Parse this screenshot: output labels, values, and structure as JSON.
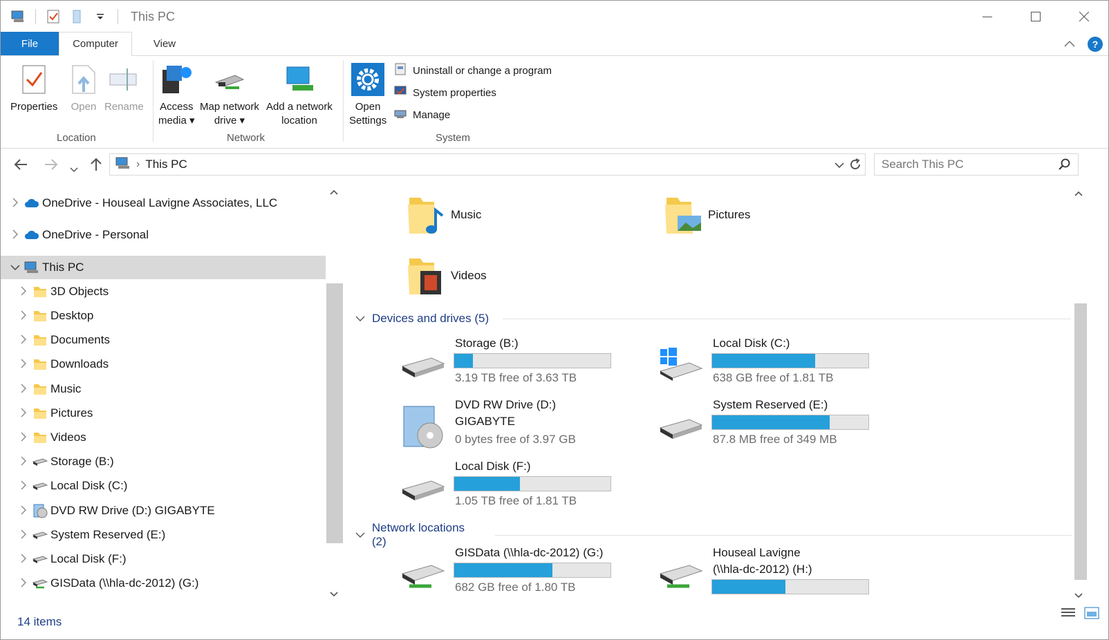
{
  "window": {
    "title": "This PC"
  },
  "tabs": {
    "file": "File",
    "computer": "Computer",
    "view": "View"
  },
  "ribbon": {
    "location": {
      "group_label": "Location",
      "properties": "Properties",
      "open": "Open",
      "rename": "Rename"
    },
    "network": {
      "group_label": "Network",
      "access_media": [
        "Access",
        "media"
      ],
      "map_drive": [
        "Map network",
        "drive"
      ],
      "add_location": [
        "Add a network",
        "location"
      ]
    },
    "system": {
      "group_label": "System",
      "open_settings": [
        "Open",
        "Settings"
      ],
      "uninstall": "Uninstall or change a program",
      "system_properties": "System properties",
      "manage": "Manage"
    }
  },
  "address": {
    "crumb": "This PC",
    "search_placeholder": "Search This PC"
  },
  "nav": {
    "items": [
      {
        "label": "OneDrive - Houseal Lavigne Associates, LLC",
        "icon": "cloud-icon"
      },
      {
        "label": "OneDrive - Personal",
        "icon": "cloud-icon"
      },
      {
        "label": "This PC",
        "icon": "computer-icon"
      },
      {
        "label": "3D Objects",
        "icon": "folder-icon"
      },
      {
        "label": "Desktop",
        "icon": "folder-icon"
      },
      {
        "label": "Documents",
        "icon": "folder-icon"
      },
      {
        "label": "Downloads",
        "icon": "folder-icon"
      },
      {
        "label": "Music",
        "icon": "folder-icon"
      },
      {
        "label": "Pictures",
        "icon": "folder-icon"
      },
      {
        "label": "Videos",
        "icon": "folder-icon"
      },
      {
        "label": "Storage (B:)",
        "icon": "drive-icon"
      },
      {
        "label": "Local Disk (C:)",
        "icon": "drive-icon"
      },
      {
        "label": "DVD RW Drive (D:) GIGABYTE",
        "icon": "dvd-icon"
      },
      {
        "label": "System Reserved (E:)",
        "icon": "drive-icon"
      },
      {
        "label": "Local Disk (F:)",
        "icon": "drive-icon"
      },
      {
        "label": "GISData (\\\\hla-dc-2012) (G:)",
        "icon": "network-drive-icon"
      }
    ]
  },
  "folders": [
    {
      "name": "Music"
    },
    {
      "name": "Pictures"
    },
    {
      "name": "Videos"
    }
  ],
  "sections": {
    "devices": "Devices and drives (5)",
    "network": "Network locations (2)"
  },
  "drives": [
    {
      "name": "Storage (B:)",
      "free": "3.19 TB free of 3.63 TB",
      "used_fraction": 0.12
    },
    {
      "name": "Local Disk (C:)",
      "free": "638 GB free of 1.81 TB",
      "used_fraction": 0.66
    },
    {
      "name": "DVD RW Drive (D:)",
      "name2": "GIGABYTE",
      "free": "0 bytes free of 3.97 GB"
    },
    {
      "name": "System Reserved (E:)",
      "free": "87.8 MB free of 349 MB",
      "used_fraction": 0.75
    },
    {
      "name": "Local Disk (F:)",
      "free": "1.05 TB free of 1.81 TB",
      "used_fraction": 0.42
    },
    {
      "name": "GISData (\\\\hla-dc-2012) (G:)",
      "free": "682 GB free of 1.80 TB",
      "used_fraction": 0.63
    },
    {
      "name": "Houseal Lavigne",
      "name2": "(\\\\hla-dc-2012) (H:)",
      "used_fraction": 0.47
    }
  ],
  "status": {
    "count": "14 items"
  },
  "colors": {
    "accent": "#1979ca",
    "bar_fill": "#26a0da",
    "section_text": "#1e3d86"
  }
}
